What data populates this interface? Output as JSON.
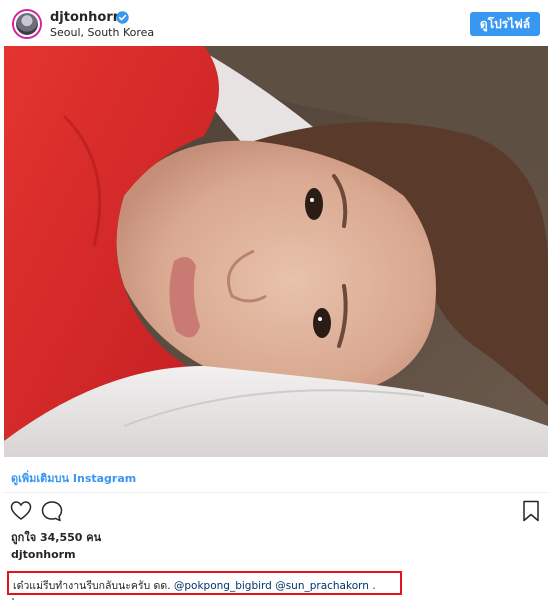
{
  "header": {
    "username": "djtonhorm",
    "location": "Seoul, South Korea",
    "verified_icon": "verified-badge-icon",
    "profile_button_label": "ดูโปรไฟล์"
  },
  "post": {
    "view_more_label": "ดูเพิ่มเติมบน Instagram",
    "likes_text": "ถูกใจ 34,550 คน",
    "owner": "djtonhorm",
    "caption_text": "เด๋วแม่รีบทำงานรีบกลับนะครับ ดด. ",
    "mention_1": "@pokpong_bigbird",
    "mention_2": "@sun_prachakorn",
    "caption_end": " ."
  },
  "colors": {
    "accent": "#3897f0",
    "highlight_box": "#e3121b",
    "text": "#262626"
  }
}
